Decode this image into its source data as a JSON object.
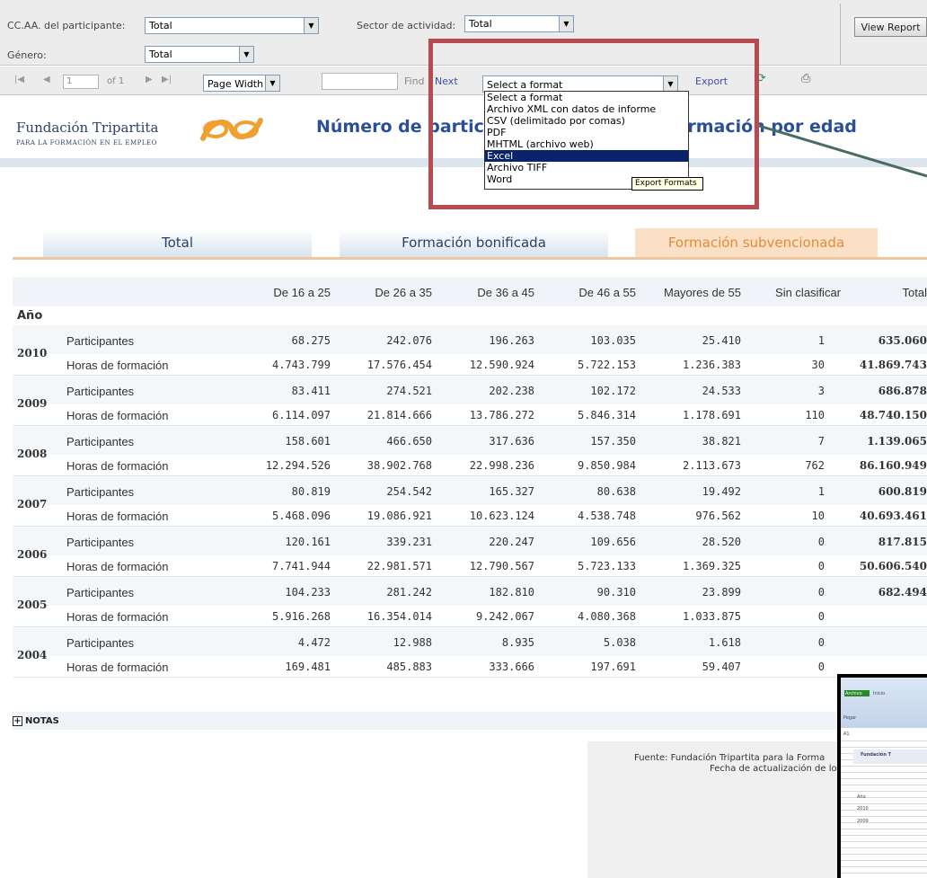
{
  "params": {
    "ccaa_label": "CC.AA. del participante:",
    "ccaa_value": "Total",
    "sector_label": "Sector de actividad:",
    "sector_value": "Total",
    "genero_label": "Género:",
    "genero_value": "Total",
    "view_report": "View Report"
  },
  "toolbar": {
    "page_value": "1",
    "of_pages": "of 1",
    "zoom": "Page Width",
    "find": "Find",
    "next": "Next",
    "format_selected": "Select a format",
    "export": "Export",
    "format_options": [
      "Select a format",
      "Archivo XML con datos de informe",
      "CSV (delimitado por comas)",
      "PDF",
      "MHTML (archivo web)",
      "Excel",
      "Archivo TIFF",
      "Word"
    ],
    "selected_option": "Excel",
    "tooltip": "Export Formats"
  },
  "header": {
    "org_name": "Fundación Tripartita",
    "org_sub": "PARA LA FORMACIÓN EN EL EMPLEO",
    "title": "Número de participantes y horas de formación por edad"
  },
  "tabs": [
    "Total",
    "Formación bonificada",
    "Formación subvencionada"
  ],
  "table": {
    "columns": [
      "De 16 a 25",
      "De 26 a 35",
      "De 36 a 45",
      "De 46 a 55",
      "Mayores de 55",
      "Sin clasificar",
      "Total"
    ],
    "anio_label": "Año",
    "row_labels": [
      "Participantes",
      "Horas de formación"
    ],
    "years": [
      {
        "year": "2010",
        "participantes": [
          "68.275",
          "242.076",
          "196.263",
          "103.035",
          "25.410",
          "1",
          "635.060"
        ],
        "horas": [
          "4.743.799",
          "17.576.454",
          "12.590.924",
          "5.722.153",
          "1.236.383",
          "30",
          "41.869.743"
        ]
      },
      {
        "year": "2009",
        "participantes": [
          "83.411",
          "274.521",
          "202.238",
          "102.172",
          "24.533",
          "3",
          "686.878"
        ],
        "horas": [
          "6.114.097",
          "21.814.666",
          "13.786.272",
          "5.846.314",
          "1.178.691",
          "110",
          "48.740.150"
        ]
      },
      {
        "year": "2008",
        "participantes": [
          "158.601",
          "466.650",
          "317.636",
          "157.350",
          "38.821",
          "7",
          "1.139.065"
        ],
        "horas": [
          "12.294.526",
          "38.902.768",
          "22.998.236",
          "9.850.984",
          "2.113.673",
          "762",
          "86.160.949"
        ]
      },
      {
        "year": "2007",
        "participantes": [
          "80.819",
          "254.542",
          "165.327",
          "80.638",
          "19.492",
          "1",
          "600.819"
        ],
        "horas": [
          "5.468.096",
          "19.086.921",
          "10.623.124",
          "4.538.748",
          "976.562",
          "10",
          "40.693.461"
        ]
      },
      {
        "year": "2006",
        "participantes": [
          "120.161",
          "339.231",
          "220.247",
          "109.656",
          "28.520",
          "0",
          "817.815"
        ],
        "horas": [
          "7.741.944",
          "22.981.571",
          "12.790.567",
          "5.723.133",
          "1.369.325",
          "0",
          "50.606.540"
        ]
      },
      {
        "year": "2005",
        "participantes": [
          "104.233",
          "281.242",
          "182.810",
          "90.310",
          "23.899",
          "0",
          "682.494"
        ],
        "horas": [
          "5.916.268",
          "16.354.014",
          "9.242.067",
          "4.080.368",
          "1.033.875",
          "0",
          ""
        ]
      },
      {
        "year": "2004",
        "participantes": [
          "4.472",
          "12.988",
          "8.935",
          "5.038",
          "1.618",
          "0",
          ""
        ],
        "horas": [
          "169.481",
          "485.883",
          "333.666",
          "197.691",
          "59.407",
          "0",
          ""
        ]
      }
    ]
  },
  "notas": "NOTAS",
  "footer": {
    "line1": "Fuente: Fundación Tripartita para la Forma",
    "line2": "Fecha de actualización de lo"
  },
  "thumbnail": {
    "ribbon_tab": "Archivo",
    "ribbon_tab2": "Inicio",
    "paste": "Pegar",
    "cell_ref": "A1",
    "title_snippet": "Fundación T",
    "year_snippet": "Año",
    "rows": [
      "2010",
      "2009"
    ]
  },
  "colors": {
    "title_blue": "#2b4e99",
    "active_tab": "#e38a3a",
    "highlight": "#b94a4f",
    "selection": "#0a246a"
  }
}
